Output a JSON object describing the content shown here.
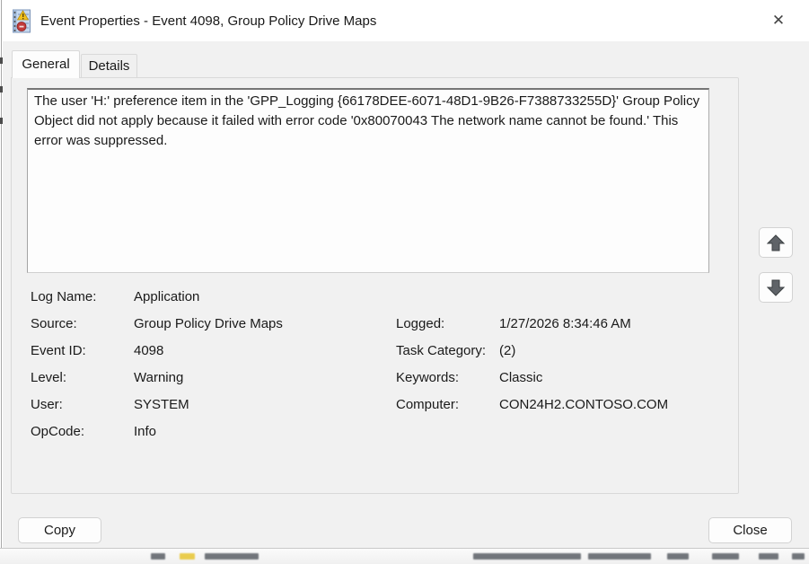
{
  "window": {
    "title": "Event Properties - Event 4098, Group Policy Drive Maps"
  },
  "tabs": [
    {
      "label": "General",
      "active": true
    },
    {
      "label": "Details",
      "active": false
    }
  ],
  "description": "The user 'H:' preference item in the 'GPP_Logging {66178DEE-6071-48D1-9B26-F7388733255D}' Group Policy Object did not apply because it failed with error code '0x80070043 The network name cannot be found.' This error was suppressed.",
  "properties": {
    "left": [
      {
        "label": "Log Name:",
        "value": "Application"
      },
      {
        "label": "Source:",
        "value": "Group Policy Drive Maps"
      },
      {
        "label": "Event ID:",
        "value": "4098"
      },
      {
        "label": "Level:",
        "value": "Warning"
      },
      {
        "label": "User:",
        "value": "SYSTEM"
      },
      {
        "label": "OpCode:",
        "value": "Info"
      }
    ],
    "right": [
      {
        "label": "Logged:",
        "value": "1/27/2026 8:34:46 AM"
      },
      {
        "label": "Task Category:",
        "value": "(2)"
      },
      {
        "label": "Keywords:",
        "value": "Classic"
      },
      {
        "label": "Computer:",
        "value": "CON24H2.CONTOSO.COM"
      }
    ]
  },
  "buttons": {
    "copy": "Copy",
    "close": "Close"
  },
  "icons": {
    "close": "✕",
    "event_warning": "event-log-notebook-with-warning-triangle-and-red-badge",
    "arrow_up": "solid-up-arrow",
    "arrow_down": "solid-down-arrow"
  },
  "colors": {
    "dialog_bg": "#f1f1f1",
    "titlebar_bg": "#ffffff",
    "textbox_bg": "#fdfdfd",
    "border": "#d9d9d9",
    "warning_yellow": "#f2c21d",
    "badge_red": "#c23b3b"
  }
}
